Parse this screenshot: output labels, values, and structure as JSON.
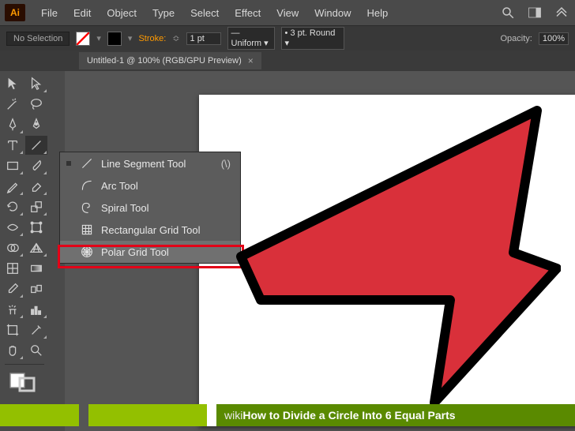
{
  "app_icon": "Ai",
  "menu": [
    "File",
    "Edit",
    "Object",
    "Type",
    "Select",
    "Effect",
    "View",
    "Window",
    "Help"
  ],
  "controlbar": {
    "selection": "No Selection",
    "stroke_label": "Stroke:",
    "stroke_value": "1 pt",
    "profile": "Uniform",
    "brush": "3 pt. Round",
    "opacity_label": "Opacity:",
    "opacity_value": "100%"
  },
  "tab": {
    "title": "Untitled-1 @ 100% (RGB/GPU Preview)"
  },
  "flyout": {
    "items": [
      {
        "label": "Line Segment Tool",
        "shortcut": "(\\)",
        "icon": "line",
        "current": true
      },
      {
        "label": "Arc Tool",
        "shortcut": "",
        "icon": "arc",
        "current": false
      },
      {
        "label": "Spiral Tool",
        "shortcut": "",
        "icon": "spiral",
        "current": false
      },
      {
        "label": "Rectangular Grid Tool",
        "shortcut": "",
        "icon": "rectgrid",
        "current": false
      },
      {
        "label": "Polar Grid Tool",
        "shortcut": "",
        "icon": "polargrid",
        "current": false
      }
    ],
    "highlighted_index": 4
  },
  "banner": {
    "site": "wiki",
    "article": "How to Divide a Circle Into 6 Equal Parts"
  }
}
